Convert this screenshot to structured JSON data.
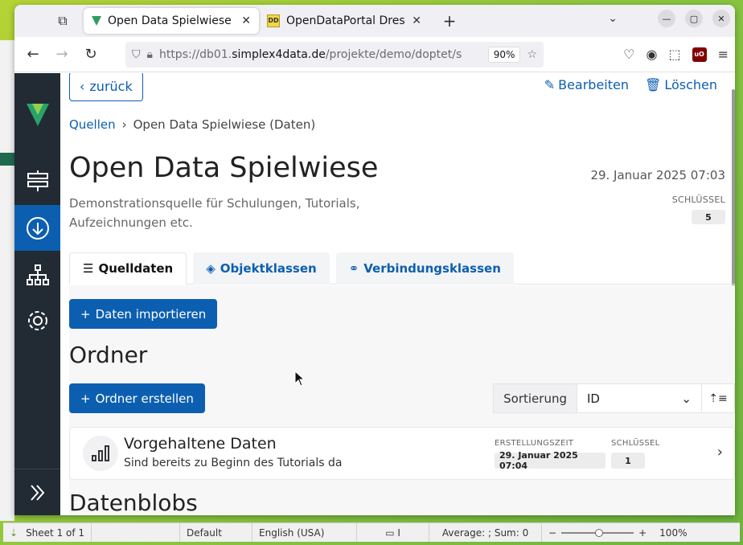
{
  "browser": {
    "tabs": [
      {
        "title": "Open Data Spielwiese - Q",
        "active": true
      },
      {
        "title": "OpenDataPortal Dresden",
        "active": false
      }
    ],
    "url_prefix": "https://db01.",
    "url_host": "simplex4data.de",
    "url_path": "/projekte/demo/doptet/s",
    "zoom": "90%"
  },
  "header": {
    "back_label": "zurück",
    "edit_label": "Bearbeiten",
    "delete_label": "Löschen"
  },
  "breadcrumb": {
    "root": "Quellen",
    "current": "Open Data Spielwiese (Daten)"
  },
  "page": {
    "title": "Open Data Spielwiese",
    "description": "Demonstrationsquelle für Schulungen, Tutorials, Aufzeichnungen etc.",
    "created": "29. Januar 2025 07:03",
    "key_label": "SCHLÜSSEL",
    "key_value": "5"
  },
  "tabs": [
    {
      "label": "Quelldaten"
    },
    {
      "label": "Objektklassen"
    },
    {
      "label": "Verbindungsklassen"
    }
  ],
  "panel": {
    "import_label": "Daten importieren",
    "folders_heading": "Ordner",
    "create_folder_label": "Ordner erstellen",
    "sort_label": "Sortierung",
    "sort_value": "ID",
    "blobs_heading": "Datenblobs"
  },
  "folder": {
    "title": "Vorgehaltene Daten",
    "subtitle": "Sind bereits zu Beginn des Tutorials da",
    "created_label": "ERSTELLUNGSZEIT",
    "created_value": "29. Januar 2025 07:04",
    "key_label": "SCHLÜSSEL",
    "key_value": "1"
  },
  "statusbar": {
    "sheet": "Sheet 1 of 1",
    "style": "Default",
    "language": "English (USA)",
    "summary": "Average: ; Sum: 0",
    "zoom": "100%"
  },
  "colors": {
    "primary": "#0c5fb0",
    "sidebar": "#222a33",
    "logo": "#27a26b"
  }
}
